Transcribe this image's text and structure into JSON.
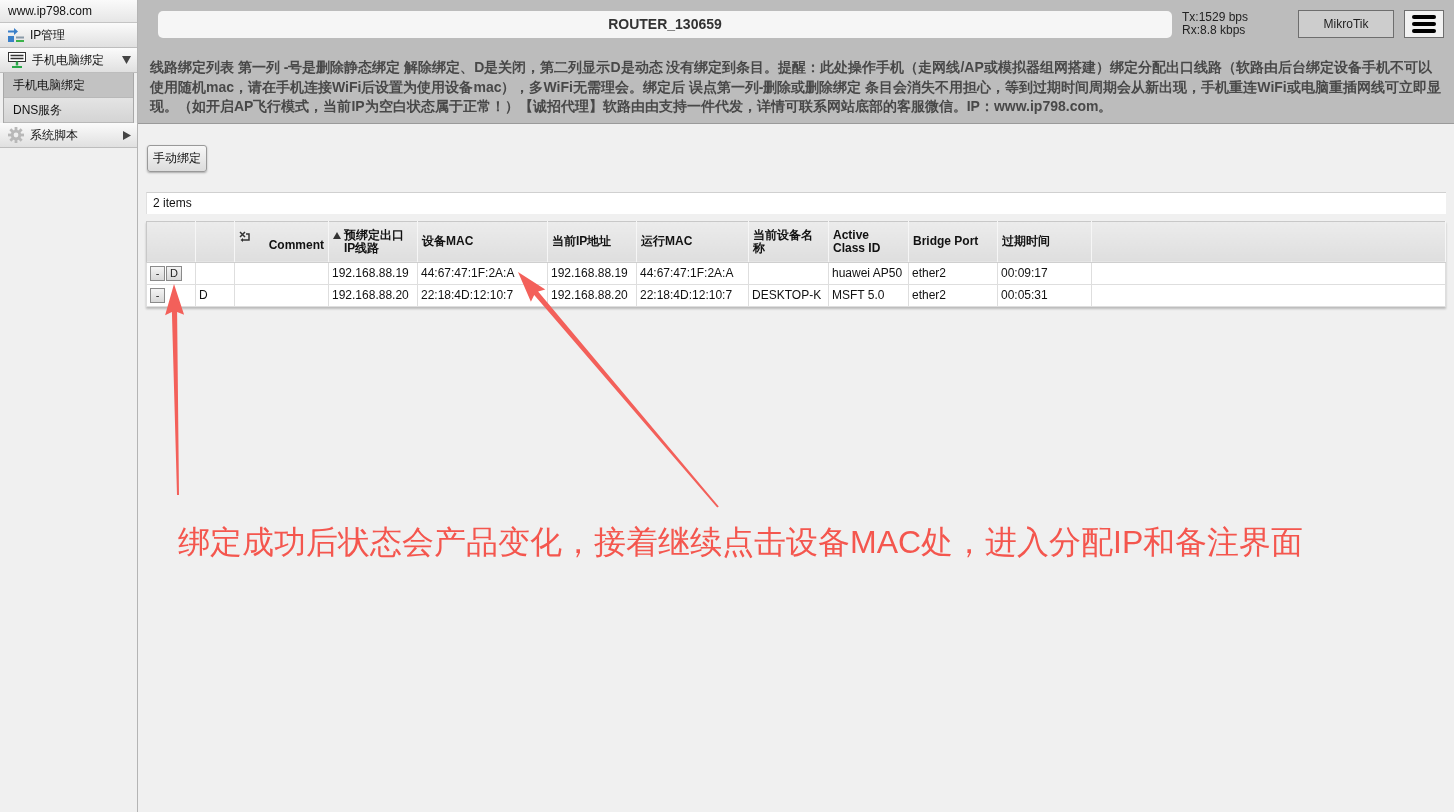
{
  "sidebar": {
    "site": "www.ip798.com",
    "items": [
      {
        "label": "IP管理",
        "kind": "link"
      },
      {
        "label": "手机电脑绑定",
        "kind": "group",
        "expanded": true,
        "children": [
          {
            "label": "手机电脑绑定",
            "selected": true
          },
          {
            "label": "DNS服务",
            "selected": false
          }
        ]
      },
      {
        "label": "系统脚本",
        "kind": "group",
        "expanded": false
      }
    ]
  },
  "header": {
    "title": "ROUTER_130659",
    "tx": "Tx:1529 bps",
    "rx": "Rx:8.8 kbps",
    "brand_button": "MikroTik",
    "notice": "线路绑定列表 第一列 -号是删除静态绑定 解除绑定、D是关闭，第二列显示D是动态 没有绑定到条目。提醒：此处操作手机（走网线/AP或模拟器组网搭建）绑定分配出口线路（软路由后台绑定设备手机不可以使用随机mac，请在手机连接WiFi后设置为使用设备mac），多WiFi无需理会。绑定后 误点第一列-删除或删除绑定 条目会消失不用担心，等到过期时间周期会从新出现，手机重连WiFi或电脑重插网线可立即显现。（如开启AP飞行模式，当前IP为空白状态属于正常！）【诚招代理】软路由由支持一件代发，详情可联系网站底部的客服微信。IP：www.ip798.com。"
  },
  "toolbar": {
    "buttons": [
      "手动绑定"
    ]
  },
  "table": {
    "count": "2 items",
    "columns": [
      {
        "kind": "actions",
        "sorted": false
      },
      {
        "kind": "text",
        "sorted": false
      },
      {
        "kind": "comment",
        "label": "Comment",
        "sorted": false
      },
      {
        "kind": "text",
        "label": "预绑定出口IP线路",
        "sorted": true
      },
      {
        "kind": "text",
        "label": "设备MAC",
        "sorted": false
      },
      {
        "kind": "text",
        "label": "当前IP地址",
        "sorted": false
      },
      {
        "kind": "text",
        "label": "运行MAC",
        "sorted": false
      },
      {
        "kind": "text",
        "label": "当前设备名称",
        "sorted": false
      },
      {
        "kind": "text",
        "label": "Active Class ID",
        "sorted": false
      },
      {
        "kind": "text",
        "label": "Bridge Port",
        "sorted": false
      },
      {
        "kind": "text",
        "label": "过期时间",
        "sorted": false
      }
    ],
    "rows": [
      {
        "buttons": [
          "-",
          "D"
        ],
        "route_ip": "192.168.88.19",
        "device_mac": "44:67:47:1F:2A:A",
        "current_ip": "192.168.88.19",
        "running_mac": "44:67:47:1F:2A:A",
        "active_class_id": "huawei AP50",
        "bridge_port": "ether2",
        "expires": "00:09:17"
      },
      {
        "buttons": [
          "-"
        ],
        "flag": "D",
        "route_ip": "192.168.88.20",
        "device_mac": "22:18:4D:12:10:7",
        "current_ip": "192.168.88.20",
        "running_mac": "22:18:4D:12:10:7",
        "device_name": "DESKTOP-K",
        "active_class_id": "MSFT 5.0",
        "bridge_port": "ether2",
        "expires": "00:05:31"
      }
    ]
  },
  "annotation": {
    "text": "绑定成功后状态会产品变化，接着继续点击设备MAC处，进入分配IP和备注界面"
  }
}
